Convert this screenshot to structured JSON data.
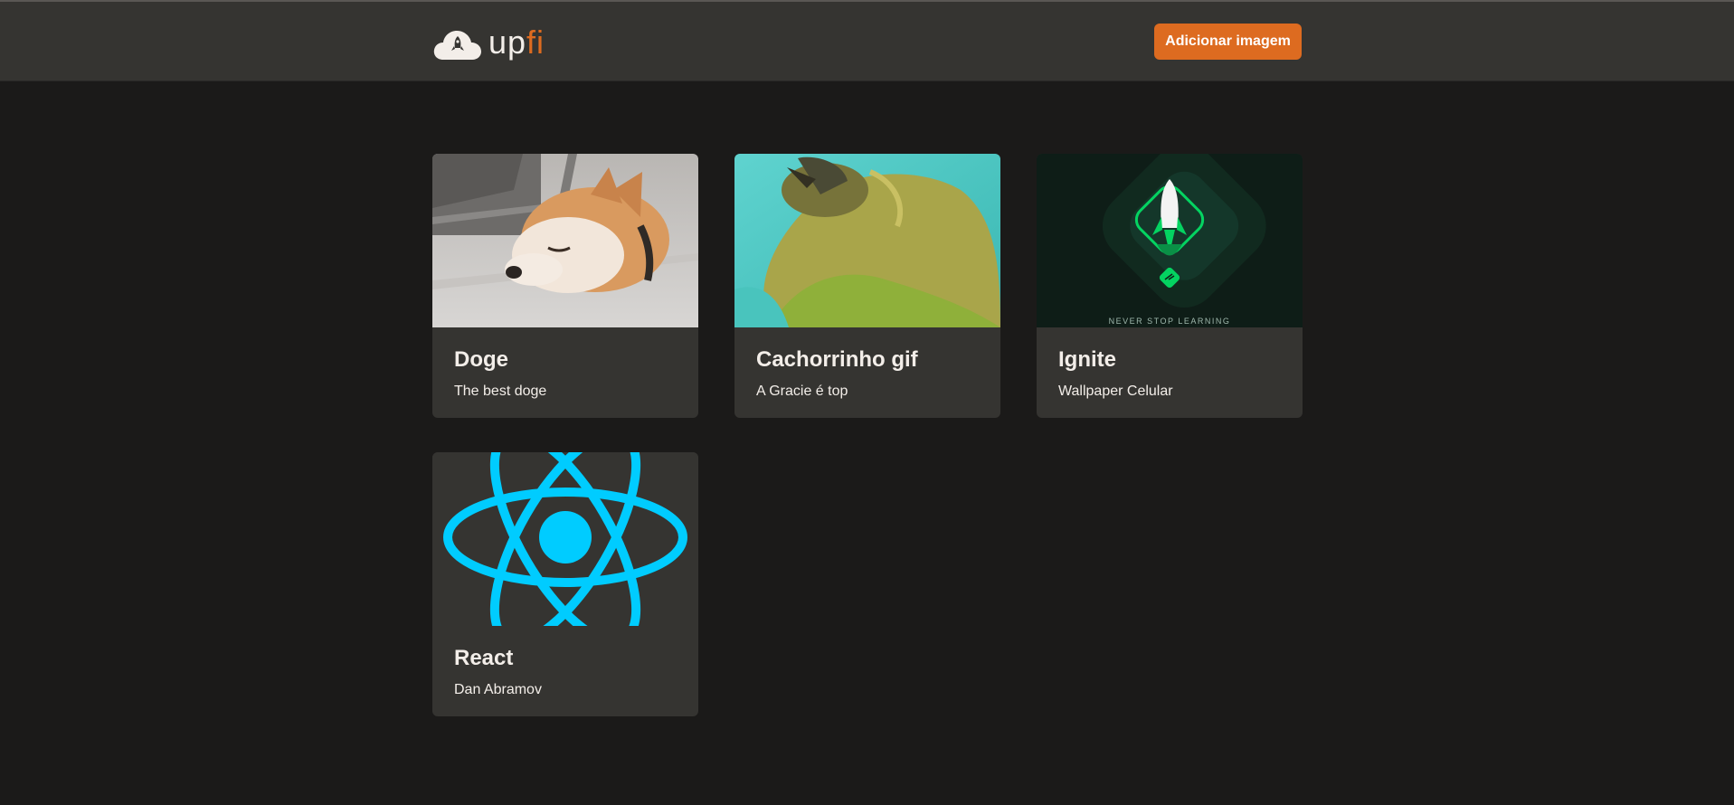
{
  "header": {
    "logo": {
      "part1": "up",
      "part2": "fi"
    },
    "add_button_label": "Adicionar imagem"
  },
  "cards": [
    {
      "title": "Doge",
      "description": "The best doge"
    },
    {
      "title": "Cachorrinho gif",
      "description": "A Gracie é top"
    },
    {
      "title": "Ignite",
      "description": "Wallpaper Celular",
      "image_caption": "NEVER STOP LEARNING"
    },
    {
      "title": "React",
      "description": "Dan Abramov"
    }
  ],
  "colors": {
    "background": "#1b1a19",
    "header": "#353431",
    "card": "#353431",
    "accent": "#dd6b20",
    "react": "#00ccff"
  }
}
